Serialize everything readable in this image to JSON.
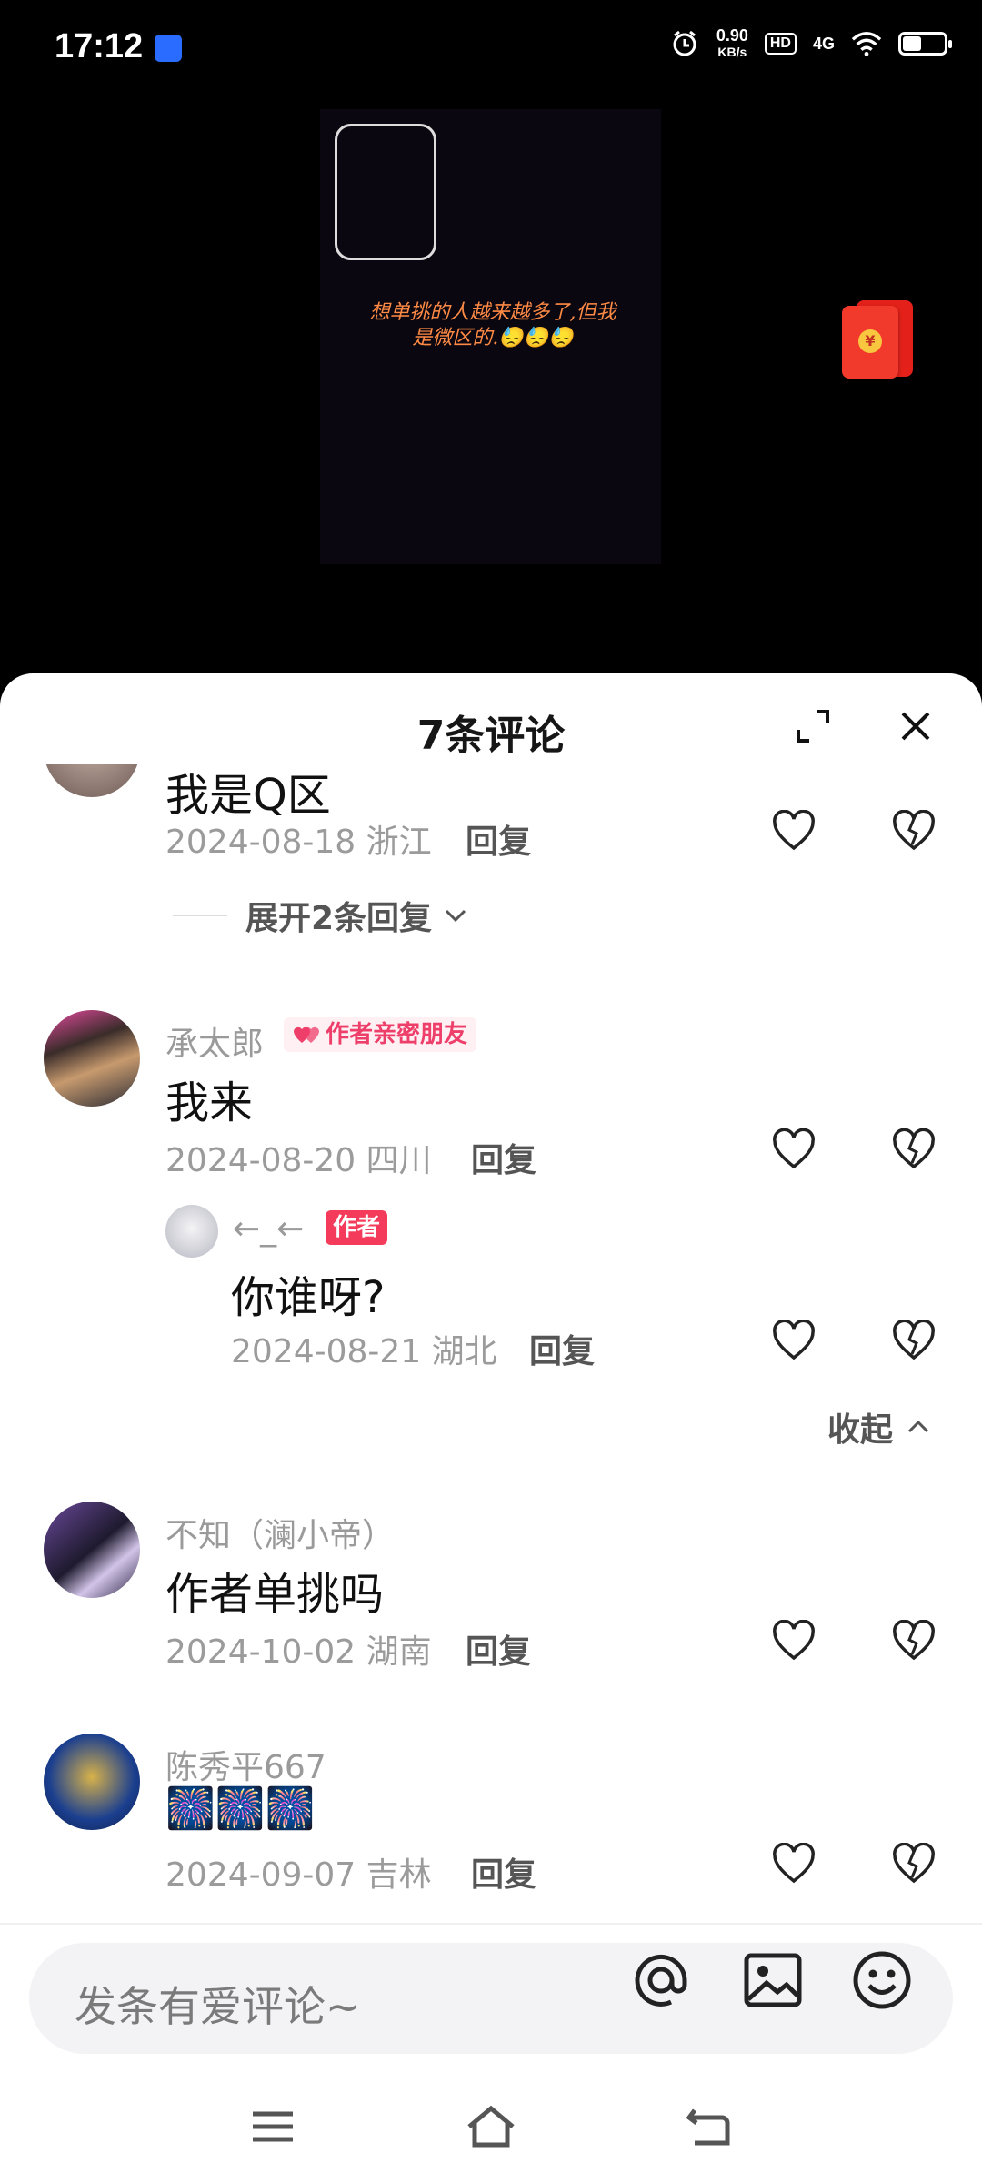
{
  "status_bar": {
    "time": "17:12",
    "net_speed_value": "0.90",
    "net_speed_unit": "KB/s",
    "hd_label": "HD",
    "network_label": "4G",
    "battery_percent": 45
  },
  "video": {
    "caption_line1": "想单挑的人越来越多了,但我",
    "caption_line2": "是微区的.",
    "caption_emoji": "😓😓😓",
    "red_packet_symbol": "¥"
  },
  "sheet": {
    "title": "7条评论"
  },
  "comments": [
    {
      "text": "我是Q区",
      "date": "2024-08-18",
      "location": "浙江",
      "reply_label": "回复",
      "expand_label": "展开2条回复"
    },
    {
      "username": "承太郎",
      "badge": "作者亲密朋友",
      "text": "我来",
      "date": "2024-08-20",
      "location": "四川",
      "reply_label": "回复",
      "sub_reply": {
        "username": "←_←",
        "badge": "作者",
        "text": "你谁呀?",
        "date": "2024-08-21",
        "location": "湖北",
        "reply_label": "回复"
      },
      "collapse_label": "收起"
    },
    {
      "username": "不知（澜小帝）",
      "text": "作者单挑吗",
      "date": "2024-10-02",
      "location": "湖南",
      "reply_label": "回复"
    },
    {
      "username": "陈秀平667",
      "text": "🎆🎆🎆",
      "date": "2024-09-07",
      "location": "吉林",
      "reply_label": "回复"
    }
  ],
  "input": {
    "placeholder": "发条有爱评论~"
  },
  "icons": {
    "like": "heart-icon",
    "dislike": "broken-heart-icon",
    "at": "at-icon",
    "image": "image-icon",
    "emoji": "emoji-icon",
    "expand": "expand-icon",
    "close": "close-icon"
  },
  "colors": {
    "badge_pink": "#ee3f6a",
    "author_badge": "#f53b5b",
    "text_gray": "#9b9b9b"
  }
}
